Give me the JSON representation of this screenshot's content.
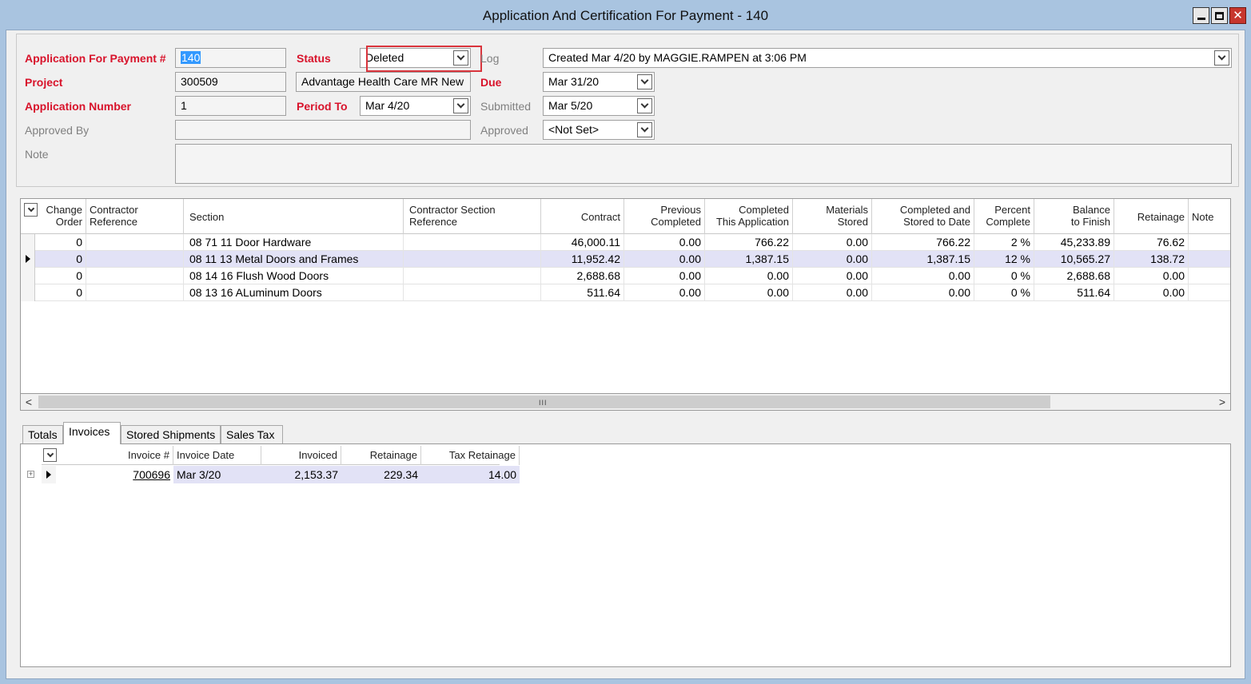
{
  "window": {
    "title": "Application And Certification For Payment - 140",
    "buttons": {
      "minimize": "minimize-icon",
      "maximize": "maximize-icon",
      "close": "✕"
    }
  },
  "form": {
    "app_payment_label": "Application For Payment #",
    "app_payment_value": "140",
    "status_label": "Status",
    "status_value": "Deleted",
    "log_label": "Log",
    "log_value": "Created Mar 4/20 by MAGGIE.RAMPEN at 3:06 PM",
    "project_label": "Project",
    "project_value": "300509",
    "project_name": "Advantage Health Care MR New",
    "due_label": "Due",
    "due_value": "Mar 31/20",
    "app_number_label": "Application Number",
    "app_number_value": "1",
    "period_to_label": "Period To",
    "period_to_value": "Mar 4/20",
    "submitted_label": "Submitted",
    "submitted_value": "Mar 5/20",
    "approved_by_label": "Approved By",
    "approved_by_value": "",
    "approved_label": "Approved",
    "approved_value": "<Not Set>",
    "note_label": "Note",
    "note_value": ""
  },
  "main_grid": {
    "headers": {
      "change_order": [
        "Change",
        "Order"
      ],
      "contractor_ref": [
        "Contractor",
        "Reference"
      ],
      "section": "Section",
      "contractor_section_ref": [
        "Contractor Section",
        "Reference"
      ],
      "contract": "Contract",
      "previous_completed": [
        "Previous",
        "Completed"
      ],
      "completed_this_app": [
        "Completed",
        "This Application"
      ],
      "materials_stored": [
        "Materials",
        "Stored"
      ],
      "completed_stored": [
        "Completed and",
        "Stored to Date"
      ],
      "percent_complete": [
        "Percent",
        "Complete"
      ],
      "balance_to_finish": [
        "Balance",
        "to Finish"
      ],
      "retainage": "Retainage",
      "note": "Note"
    },
    "rows": [
      {
        "change_order": "0",
        "contractor_ref": "",
        "section": "08 71 11 Door Hardware",
        "contractor_section_ref": "",
        "contract": "46,000.11",
        "previous_completed": "0.00",
        "completed_this_app": "766.22",
        "materials_stored": "0.00",
        "completed_stored": "766.22",
        "percent_complete": "2 %",
        "balance_to_finish": "45,233.89",
        "retainage": "76.62",
        "note": ""
      },
      {
        "change_order": "0",
        "contractor_ref": "",
        "section": "08 11 13 Metal Doors and Frames",
        "contractor_section_ref": "",
        "contract": "11,952.42",
        "previous_completed": "0.00",
        "completed_this_app": "1,387.15",
        "materials_stored": "0.00",
        "completed_stored": "1,387.15",
        "percent_complete": "12 %",
        "balance_to_finish": "10,565.27",
        "retainage": "138.72",
        "note": ""
      },
      {
        "change_order": "0",
        "contractor_ref": "",
        "section": "08 14 16 Flush Wood Doors",
        "contractor_section_ref": "",
        "contract": "2,688.68",
        "previous_completed": "0.00",
        "completed_this_app": "0.00",
        "materials_stored": "0.00",
        "completed_stored": "0.00",
        "percent_complete": "0 %",
        "balance_to_finish": "2,688.68",
        "retainage": "0.00",
        "note": ""
      },
      {
        "change_order": "0",
        "contractor_ref": "",
        "section": "08 13 16 ALuminum Doors",
        "contractor_section_ref": "",
        "contract": "511.64",
        "previous_completed": "0.00",
        "completed_this_app": "0.00",
        "materials_stored": "0.00",
        "completed_stored": "0.00",
        "percent_complete": "0 %",
        "balance_to_finish": "511.64",
        "retainage": "0.00",
        "note": ""
      }
    ],
    "scroll_left": "<",
    "scroll_right": ">",
    "scroll_grip": "III"
  },
  "tabs": [
    "Totals",
    "Invoices",
    "Stored Shipments",
    "Sales Tax"
  ],
  "invoices_grid": {
    "headers": {
      "invoice_no": "Invoice #",
      "invoice_date": "Invoice Date",
      "invoiced": "Invoiced",
      "retainage": "Retainage",
      "tax_retainage": "Tax Retainage"
    },
    "rows": [
      {
        "invoice_no": "700696",
        "invoice_date": "Mar 3/20",
        "invoiced": "2,153.37",
        "retainage": "229.34",
        "tax_retainage": "14.00"
      }
    ],
    "expander": "+"
  }
}
